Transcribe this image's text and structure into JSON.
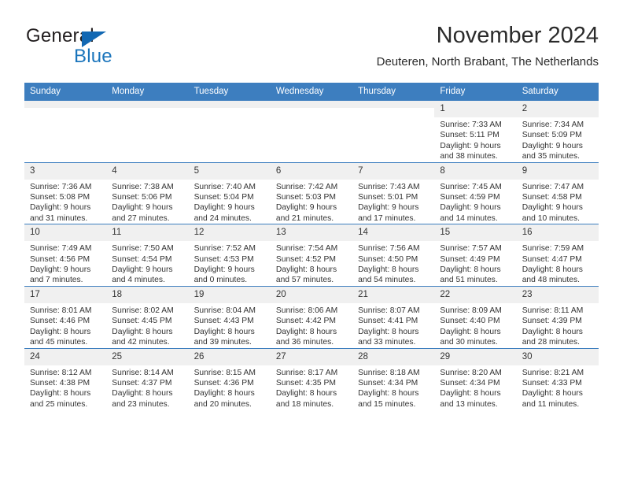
{
  "brand": {
    "name_part1": "General",
    "name_part2": "Blue"
  },
  "header": {
    "title": "November 2024",
    "subtitle": "Deuteren, North Brabant, The Netherlands"
  },
  "colors": {
    "header_blue": "#3d7ebf",
    "brand_blue": "#1b75bc",
    "daynum_band": "#f0f0f0"
  },
  "weekday_headers": [
    "Sunday",
    "Monday",
    "Tuesday",
    "Wednesday",
    "Thursday",
    "Friday",
    "Saturday"
  ],
  "weeks": [
    [
      {
        "day": "",
        "empty": true
      },
      {
        "day": "",
        "empty": true
      },
      {
        "day": "",
        "empty": true
      },
      {
        "day": "",
        "empty": true
      },
      {
        "day": "",
        "empty": true
      },
      {
        "day": "1",
        "sunrise": "Sunrise: 7:33 AM",
        "sunset": "Sunset: 5:11 PM",
        "daylight_line1": "Daylight: 9 hours",
        "daylight_line2": "and 38 minutes."
      },
      {
        "day": "2",
        "sunrise": "Sunrise: 7:34 AM",
        "sunset": "Sunset: 5:09 PM",
        "daylight_line1": "Daylight: 9 hours",
        "daylight_line2": "and 35 minutes."
      }
    ],
    [
      {
        "day": "3",
        "sunrise": "Sunrise: 7:36 AM",
        "sunset": "Sunset: 5:08 PM",
        "daylight_line1": "Daylight: 9 hours",
        "daylight_line2": "and 31 minutes."
      },
      {
        "day": "4",
        "sunrise": "Sunrise: 7:38 AM",
        "sunset": "Sunset: 5:06 PM",
        "daylight_line1": "Daylight: 9 hours",
        "daylight_line2": "and 27 minutes."
      },
      {
        "day": "5",
        "sunrise": "Sunrise: 7:40 AM",
        "sunset": "Sunset: 5:04 PM",
        "daylight_line1": "Daylight: 9 hours",
        "daylight_line2": "and 24 minutes."
      },
      {
        "day": "6",
        "sunrise": "Sunrise: 7:42 AM",
        "sunset": "Sunset: 5:03 PM",
        "daylight_line1": "Daylight: 9 hours",
        "daylight_line2": "and 21 minutes."
      },
      {
        "day": "7",
        "sunrise": "Sunrise: 7:43 AM",
        "sunset": "Sunset: 5:01 PM",
        "daylight_line1": "Daylight: 9 hours",
        "daylight_line2": "and 17 minutes."
      },
      {
        "day": "8",
        "sunrise": "Sunrise: 7:45 AM",
        "sunset": "Sunset: 4:59 PM",
        "daylight_line1": "Daylight: 9 hours",
        "daylight_line2": "and 14 minutes."
      },
      {
        "day": "9",
        "sunrise": "Sunrise: 7:47 AM",
        "sunset": "Sunset: 4:58 PM",
        "daylight_line1": "Daylight: 9 hours",
        "daylight_line2": "and 10 minutes."
      }
    ],
    [
      {
        "day": "10",
        "sunrise": "Sunrise: 7:49 AM",
        "sunset": "Sunset: 4:56 PM",
        "daylight_line1": "Daylight: 9 hours",
        "daylight_line2": "and 7 minutes."
      },
      {
        "day": "11",
        "sunrise": "Sunrise: 7:50 AM",
        "sunset": "Sunset: 4:54 PM",
        "daylight_line1": "Daylight: 9 hours",
        "daylight_line2": "and 4 minutes."
      },
      {
        "day": "12",
        "sunrise": "Sunrise: 7:52 AM",
        "sunset": "Sunset: 4:53 PM",
        "daylight_line1": "Daylight: 9 hours",
        "daylight_line2": "and 0 minutes."
      },
      {
        "day": "13",
        "sunrise": "Sunrise: 7:54 AM",
        "sunset": "Sunset: 4:52 PM",
        "daylight_line1": "Daylight: 8 hours",
        "daylight_line2": "and 57 minutes."
      },
      {
        "day": "14",
        "sunrise": "Sunrise: 7:56 AM",
        "sunset": "Sunset: 4:50 PM",
        "daylight_line1": "Daylight: 8 hours",
        "daylight_line2": "and 54 minutes."
      },
      {
        "day": "15",
        "sunrise": "Sunrise: 7:57 AM",
        "sunset": "Sunset: 4:49 PM",
        "daylight_line1": "Daylight: 8 hours",
        "daylight_line2": "and 51 minutes."
      },
      {
        "day": "16",
        "sunrise": "Sunrise: 7:59 AM",
        "sunset": "Sunset: 4:47 PM",
        "daylight_line1": "Daylight: 8 hours",
        "daylight_line2": "and 48 minutes."
      }
    ],
    [
      {
        "day": "17",
        "sunrise": "Sunrise: 8:01 AM",
        "sunset": "Sunset: 4:46 PM",
        "daylight_line1": "Daylight: 8 hours",
        "daylight_line2": "and 45 minutes."
      },
      {
        "day": "18",
        "sunrise": "Sunrise: 8:02 AM",
        "sunset": "Sunset: 4:45 PM",
        "daylight_line1": "Daylight: 8 hours",
        "daylight_line2": "and 42 minutes."
      },
      {
        "day": "19",
        "sunrise": "Sunrise: 8:04 AM",
        "sunset": "Sunset: 4:43 PM",
        "daylight_line1": "Daylight: 8 hours",
        "daylight_line2": "and 39 minutes."
      },
      {
        "day": "20",
        "sunrise": "Sunrise: 8:06 AM",
        "sunset": "Sunset: 4:42 PM",
        "daylight_line1": "Daylight: 8 hours",
        "daylight_line2": "and 36 minutes."
      },
      {
        "day": "21",
        "sunrise": "Sunrise: 8:07 AM",
        "sunset": "Sunset: 4:41 PM",
        "daylight_line1": "Daylight: 8 hours",
        "daylight_line2": "and 33 minutes."
      },
      {
        "day": "22",
        "sunrise": "Sunrise: 8:09 AM",
        "sunset": "Sunset: 4:40 PM",
        "daylight_line1": "Daylight: 8 hours",
        "daylight_line2": "and 30 minutes."
      },
      {
        "day": "23",
        "sunrise": "Sunrise: 8:11 AM",
        "sunset": "Sunset: 4:39 PM",
        "daylight_line1": "Daylight: 8 hours",
        "daylight_line2": "and 28 minutes."
      }
    ],
    [
      {
        "day": "24",
        "sunrise": "Sunrise: 8:12 AM",
        "sunset": "Sunset: 4:38 PM",
        "daylight_line1": "Daylight: 8 hours",
        "daylight_line2": "and 25 minutes."
      },
      {
        "day": "25",
        "sunrise": "Sunrise: 8:14 AM",
        "sunset": "Sunset: 4:37 PM",
        "daylight_line1": "Daylight: 8 hours",
        "daylight_line2": "and 23 minutes."
      },
      {
        "day": "26",
        "sunrise": "Sunrise: 8:15 AM",
        "sunset": "Sunset: 4:36 PM",
        "daylight_line1": "Daylight: 8 hours",
        "daylight_line2": "and 20 minutes."
      },
      {
        "day": "27",
        "sunrise": "Sunrise: 8:17 AM",
        "sunset": "Sunset: 4:35 PM",
        "daylight_line1": "Daylight: 8 hours",
        "daylight_line2": "and 18 minutes."
      },
      {
        "day": "28",
        "sunrise": "Sunrise: 8:18 AM",
        "sunset": "Sunset: 4:34 PM",
        "daylight_line1": "Daylight: 8 hours",
        "daylight_line2": "and 15 minutes."
      },
      {
        "day": "29",
        "sunrise": "Sunrise: 8:20 AM",
        "sunset": "Sunset: 4:34 PM",
        "daylight_line1": "Daylight: 8 hours",
        "daylight_line2": "and 13 minutes."
      },
      {
        "day": "30",
        "sunrise": "Sunrise: 8:21 AM",
        "sunset": "Sunset: 4:33 PM",
        "daylight_line1": "Daylight: 8 hours",
        "daylight_line2": "and 11 minutes."
      }
    ]
  ]
}
